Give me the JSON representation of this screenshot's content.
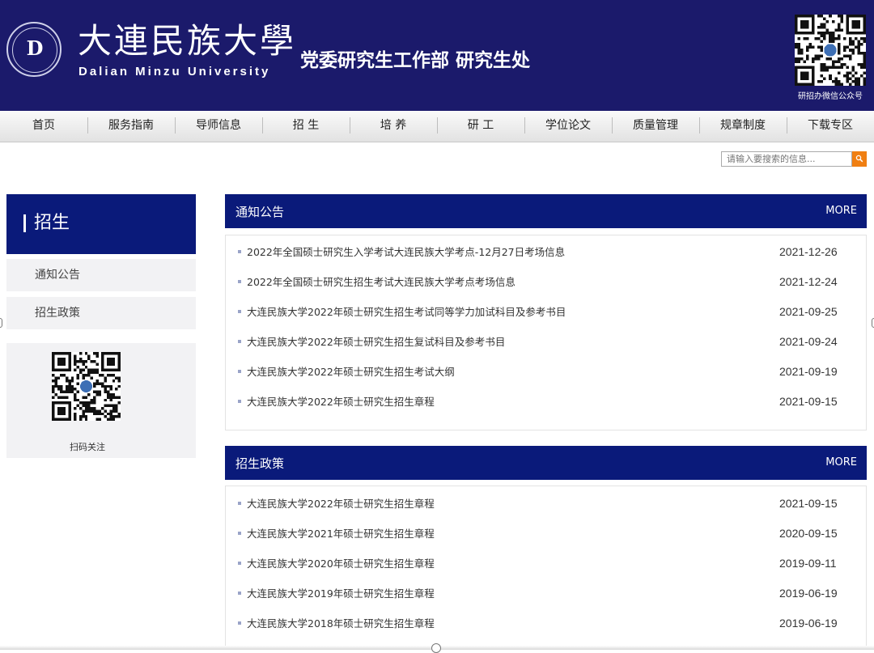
{
  "header": {
    "logo_seal_letter": "D",
    "university_cn": "大連民族大學",
    "university_en": "Dalian Minzu University",
    "department": "党委研究生工作部  研究生处",
    "qr_caption": "研招办微信公众号"
  },
  "nav": [
    "首页",
    "服务指南",
    "导师信息",
    "招 生",
    "培 养",
    "研 工",
    "学位论文",
    "质量管理",
    "规章制度",
    "下载专区"
  ],
  "search": {
    "placeholder": "请输入要搜索的信息..."
  },
  "sidebar": {
    "title": "招生",
    "items": [
      "通知公告",
      "招生政策"
    ],
    "qr_caption": "扫码关注"
  },
  "panels": [
    {
      "title": "通知公告",
      "more": "MORE",
      "rows": [
        {
          "title": "2022年全国硕士研究生入学考试大连民族大学考点-12月27日考场信息",
          "date": "2021-12-26"
        },
        {
          "title": "2022年全国硕士研究生招生考试大连民族大学考点考场信息",
          "date": "2021-12-24"
        },
        {
          "title": "大连民族大学2022年硕士研究生招生考试同等学力加试科目及参考书目",
          "date": "2021-09-25"
        },
        {
          "title": "大连民族大学2022年硕士研究生招生复试科目及参考书目",
          "date": "2021-09-24"
        },
        {
          "title": "大连民族大学2022年硕士研究生招生考试大纲",
          "date": "2021-09-19"
        },
        {
          "title": "大连民族大学2022年硕士研究生招生章程",
          "date": "2021-09-15"
        }
      ]
    },
    {
      "title": "招生政策",
      "more": "MORE",
      "rows": [
        {
          "title": "大连民族大学2022年硕士研究生招生章程",
          "date": "2021-09-15"
        },
        {
          "title": "大连民族大学2021年硕士研究生招生章程",
          "date": "2020-09-15"
        },
        {
          "title": "大连民族大学2020年硕士研究生招生章程",
          "date": "2019-09-11"
        },
        {
          "title": "大连民族大学2019年硕士研究生招生章程",
          "date": "2019-06-19"
        },
        {
          "title": "大连民族大学2018年硕士研究生招生章程",
          "date": "2019-06-19"
        }
      ]
    }
  ],
  "colors": {
    "header_bg": "#1b1a6b",
    "accent_navy": "#0a1a7a",
    "search_button": "#f07f12"
  }
}
